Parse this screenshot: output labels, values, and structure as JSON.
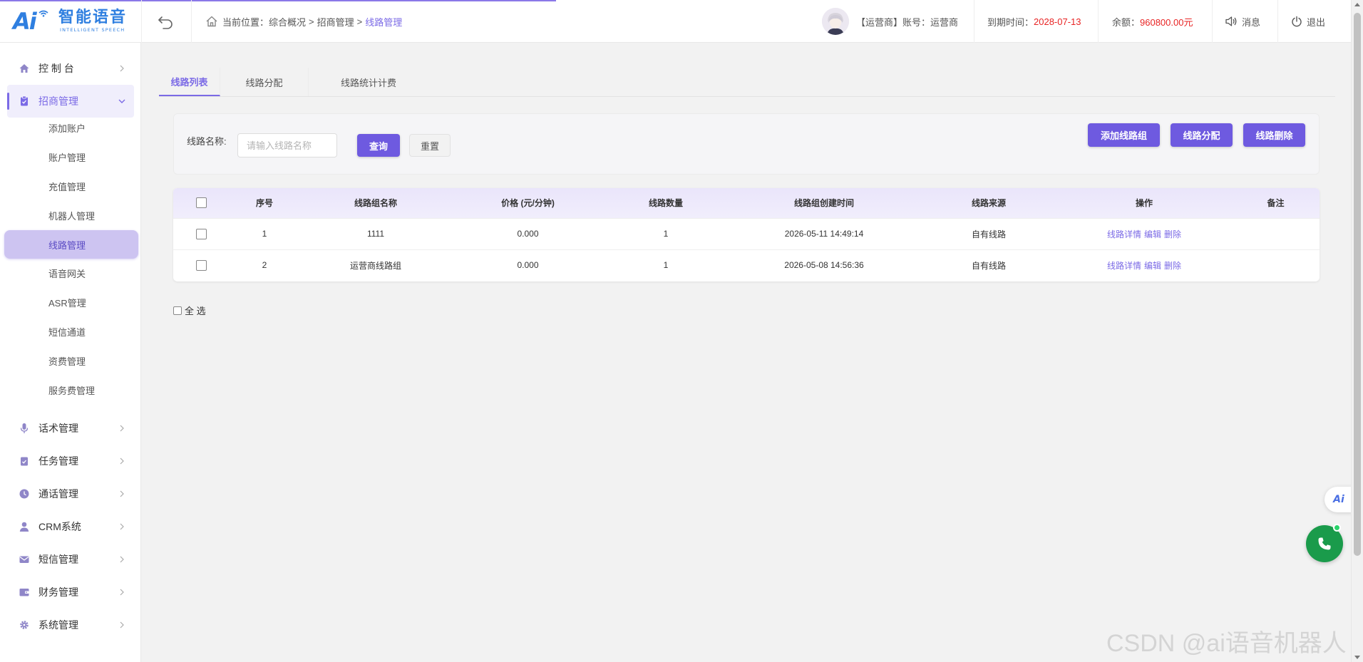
{
  "header": {
    "logo_text": "智能语音",
    "logo_ai": "Ai",
    "logo_sub": "INTELLIGENT SPEECH",
    "breadcrumb": {
      "prefix": "当前位置：",
      "items": [
        "综合概况",
        "招商管理",
        "线路管理"
      ],
      "separator": ">"
    },
    "user_role": "【运营商】账号：运营商",
    "expire_label": "到期时间：",
    "expire_value": "2028-07-13",
    "balance_label": "余额：",
    "balance_value": "960800.00元",
    "message_label": "消息",
    "logout_label": "退出"
  },
  "sidebar": {
    "items": [
      {
        "label": "控 制 台",
        "icon": "home-icon"
      },
      {
        "label": "招商管理",
        "icon": "clipboard-icon"
      },
      {
        "label": "话术管理",
        "icon": "microphone-icon"
      },
      {
        "label": "任务管理",
        "icon": "task-icon"
      },
      {
        "label": "通话管理",
        "icon": "clock-icon"
      },
      {
        "label": "CRM系统",
        "icon": "user-icon"
      },
      {
        "label": "短信管理",
        "icon": "mail-icon"
      },
      {
        "label": "财务管理",
        "icon": "wallet-icon"
      },
      {
        "label": "系统管理",
        "icon": "gear-icon"
      }
    ],
    "sub_items": [
      "添加账户",
      "账户管理",
      "充值管理",
      "机器人管理",
      "线路管理",
      "语音网关",
      "ASR管理",
      "短信通道",
      "资费管理",
      "服务费管理"
    ]
  },
  "tabs": [
    "线路列表",
    "线路分配",
    "线路统计计费"
  ],
  "search": {
    "label": "线路名称:",
    "placeholder": "请输入线路名称",
    "value": "",
    "query_label": "查询",
    "reset_label": "重置"
  },
  "actions": {
    "add_group": "添加线路组",
    "assign": "线路分配",
    "delete": "线路删除"
  },
  "table": {
    "columns": [
      "序号",
      "线路组名称",
      "价格 (元/分钟)",
      "线路数量",
      "线路组创建时间",
      "线路来源",
      "操作",
      "备注"
    ],
    "rows": [
      {
        "index": "1",
        "name": "1111",
        "price": "0.000",
        "count": "1",
        "created": "2026-05-11 14:49:14",
        "source": "自有线路",
        "remark": ""
      },
      {
        "index": "2",
        "name": "运营商线路组",
        "price": "0.000",
        "count": "1",
        "created": "2026-05-08 14:56:36",
        "source": "自有线路",
        "remark": ""
      }
    ],
    "ops": {
      "detail": "线路详情",
      "edit": "编辑",
      "delete": "删除"
    }
  },
  "select_all_label": "全 选",
  "watermark": "CSDN @ai语音机器人",
  "colors": {
    "accent": "#7b6ae6",
    "primary_button": "#6e5ae0",
    "warning_text": "#e82424",
    "phone_button": "#1a9b4b"
  }
}
